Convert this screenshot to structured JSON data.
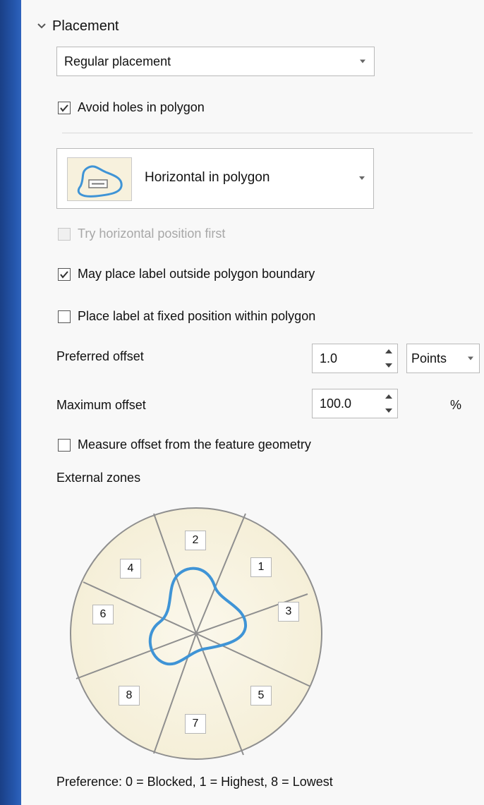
{
  "placement_section": {
    "title": "Placement",
    "mode_dropdown": {
      "value": "Regular placement"
    },
    "avoid_holes": {
      "label": "Avoid holes in polygon",
      "checked": true
    },
    "placement_style": {
      "label": "Horizontal in polygon",
      "icon": "polygon-label-placement-icon"
    },
    "try_horizontal": {
      "label": "Try horizontal position first",
      "checked": false,
      "disabled": true
    },
    "outside_boundary": {
      "label": "May place label outside polygon boundary",
      "checked": true
    },
    "fixed_position": {
      "label": "Place label at fixed position within polygon",
      "checked": false
    },
    "preferred_offset": {
      "label": "Preferred offset",
      "value": "1.0",
      "unit": "Points"
    },
    "maximum_offset": {
      "label": "Maximum offset",
      "value": "100.0",
      "unit": "%"
    },
    "measure_offset": {
      "label": "Measure offset from the feature geometry",
      "checked": false
    },
    "external_zones": {
      "label": "External zones",
      "zones": [
        "2",
        "1",
        "4",
        "6",
        "3",
        "8",
        "5",
        "7"
      ]
    },
    "preference_text": "Preference: 0 = Blocked, 1 = Highest, 8 = Lowest"
  },
  "colors": {
    "window_blue": "#1f4ea0",
    "panel_bg": "#f8f8f8",
    "zone_fill": "#f7f1dd",
    "outline_blue": "#3f94d6"
  }
}
